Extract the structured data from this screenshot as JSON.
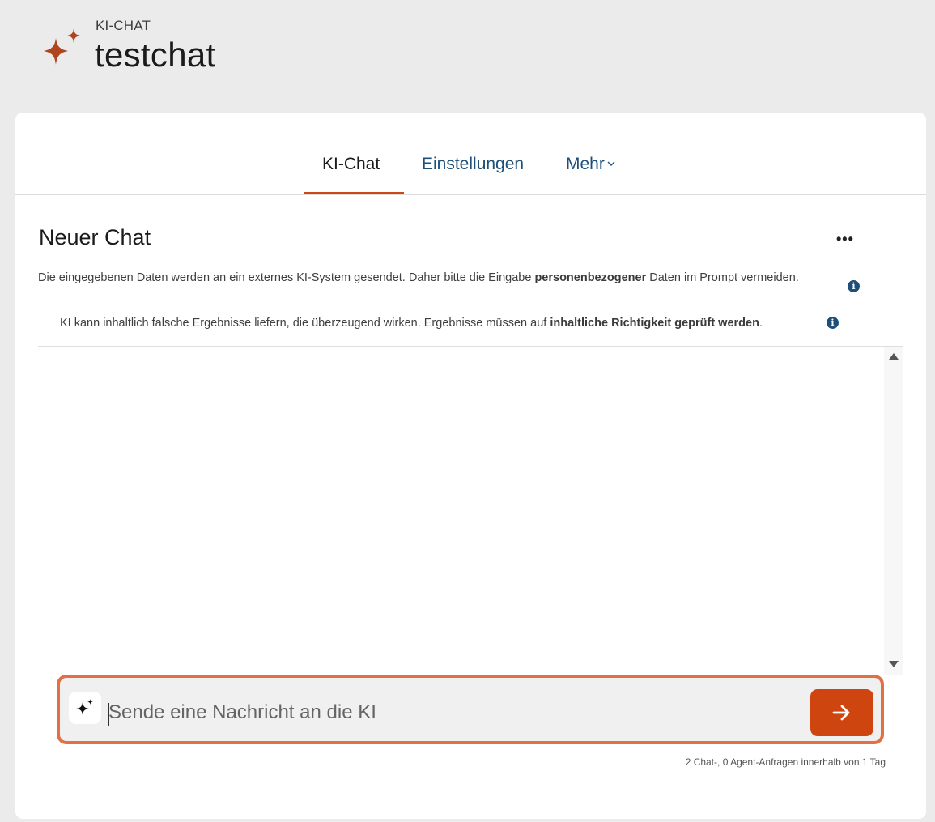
{
  "header": {
    "kicker": "KI-CHAT",
    "title": "testchat",
    "logo_icon": "sparkle-icon",
    "logo_color": "#b0441e"
  },
  "tabs": [
    {
      "label": "KI-Chat",
      "active": true
    },
    {
      "label": "Einstellungen",
      "active": false
    },
    {
      "label": "Mehr",
      "active": false,
      "has_dropdown": true
    }
  ],
  "chat": {
    "title": "Neuer Chat",
    "more_label": "•••",
    "notice1": {
      "before": "Die eingegebenen Daten werden an ein externes KI-System gesendet. Daher bitte die Eingabe ",
      "bold": "personenbezogener",
      "after": " Daten im Prompt vermeiden."
    },
    "notice2": {
      "before": "KI kann inhaltlich falsche Ergebnisse liefern, die überzeugend wirken. Ergebnisse müssen auf ",
      "bold": "inhaltliche Richtigkeit geprüft werden",
      "after": "."
    },
    "info_label": "i"
  },
  "composer": {
    "placeholder": "Sende eine Nachricht an die KI",
    "value": "",
    "send_icon": "arrow-right-icon",
    "ai_icon": "sparkle-icon"
  },
  "quota": "2 Chat-, 0 Agent-Anfragen innerhalb von 1 Tag",
  "colors": {
    "accent": "#cf4510",
    "focus_border": "#e27043",
    "link": "#1d4f7a"
  }
}
